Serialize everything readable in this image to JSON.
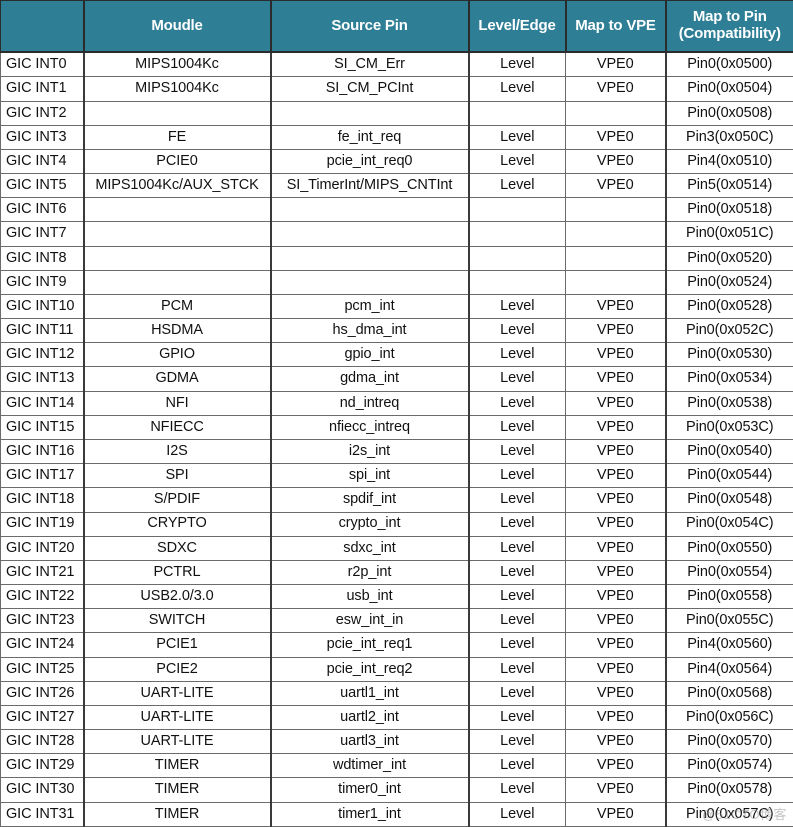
{
  "table": {
    "headers": {
      "interrupt": "",
      "module": "Moudle",
      "source_pin": "Source Pin",
      "level_edge": "Level/Edge",
      "map_to_vpe": "Map to VPE",
      "map_to_pin_line1": "Map to Pin",
      "map_to_pin_line2": "(Compatibility)"
    },
    "header_bg_color": "#2e7f96",
    "header_text_color": "#ffffff",
    "body_text_color": "#111111",
    "rows": [
      {
        "interrupt": "GIC INT0",
        "module": "MIPS1004Kc",
        "source_pin": "SI_CM_Err",
        "level_edge": "Level",
        "map_to_vpe": "VPE0",
        "map_to_pin": "Pin0(0x0500)"
      },
      {
        "interrupt": "GIC INT1",
        "module": "MIPS1004Kc",
        "source_pin": "SI_CM_PCInt",
        "level_edge": "Level",
        "map_to_vpe": "VPE0",
        "map_to_pin": "Pin0(0x0504)"
      },
      {
        "interrupt": "GIC INT2",
        "module": "",
        "source_pin": "",
        "level_edge": "",
        "map_to_vpe": "",
        "map_to_pin": "Pin0(0x0508)"
      },
      {
        "interrupt": "GIC INT3",
        "module": "FE",
        "source_pin": "fe_int_req",
        "level_edge": "Level",
        "map_to_vpe": "VPE0",
        "map_to_pin": "Pin3(0x050C)"
      },
      {
        "interrupt": "GIC INT4",
        "module": "PCIE0",
        "source_pin": "pcie_int_req0",
        "level_edge": "Level",
        "map_to_vpe": "VPE0",
        "map_to_pin": "Pin4(0x0510)"
      },
      {
        "interrupt": "GIC INT5",
        "module": "MIPS1004Kc/AUX_STCK",
        "source_pin": "SI_TimerInt/MIPS_CNTInt",
        "level_edge": "Level",
        "map_to_vpe": "VPE0",
        "map_to_pin": "Pin5(0x0514)"
      },
      {
        "interrupt": "GIC INT6",
        "module": "",
        "source_pin": "",
        "level_edge": "",
        "map_to_vpe": "",
        "map_to_pin": "Pin0(0x0518)"
      },
      {
        "interrupt": "GIC INT7",
        "module": "",
        "source_pin": "",
        "level_edge": "",
        "map_to_vpe": "",
        "map_to_pin": "Pin0(0x051C)"
      },
      {
        "interrupt": "GIC INT8",
        "module": "",
        "source_pin": "",
        "level_edge": "",
        "map_to_vpe": "",
        "map_to_pin": "Pin0(0x0520)"
      },
      {
        "interrupt": "GIC INT9",
        "module": "",
        "source_pin": "",
        "level_edge": "",
        "map_to_vpe": "",
        "map_to_pin": "Pin0(0x0524)"
      },
      {
        "interrupt": "GIC INT10",
        "module": "PCM",
        "source_pin": "pcm_int",
        "level_edge": "Level",
        "map_to_vpe": "VPE0",
        "map_to_pin": "Pin0(0x0528)"
      },
      {
        "interrupt": "GIC INT11",
        "module": "HSDMA",
        "source_pin": "hs_dma_int",
        "level_edge": "Level",
        "map_to_vpe": "VPE0",
        "map_to_pin": "Pin0(0x052C)"
      },
      {
        "interrupt": "GIC INT12",
        "module": "GPIO",
        "source_pin": "gpio_int",
        "level_edge": "Level",
        "map_to_vpe": "VPE0",
        "map_to_pin": "Pin0(0x0530)"
      },
      {
        "interrupt": "GIC INT13",
        "module": "GDMA",
        "source_pin": "gdma_int",
        "level_edge": "Level",
        "map_to_vpe": "VPE0",
        "map_to_pin": "Pin0(0x0534)"
      },
      {
        "interrupt": "GIC INT14",
        "module": "NFI",
        "source_pin": "nd_intreq",
        "level_edge": "Level",
        "map_to_vpe": "VPE0",
        "map_to_pin": "Pin0(0x0538)"
      },
      {
        "interrupt": "GIC INT15",
        "module": "NFIECC",
        "source_pin": "nfiecc_intreq",
        "level_edge": "Level",
        "map_to_vpe": "VPE0",
        "map_to_pin": "Pin0(0x053C)"
      },
      {
        "interrupt": "GIC INT16",
        "module": "I2S",
        "source_pin": "i2s_int",
        "level_edge": "Level",
        "map_to_vpe": "VPE0",
        "map_to_pin": "Pin0(0x0540)"
      },
      {
        "interrupt": "GIC INT17",
        "module": "SPI",
        "source_pin": "spi_int",
        "level_edge": "Level",
        "map_to_vpe": "VPE0",
        "map_to_pin": "Pin0(0x0544)"
      },
      {
        "interrupt": "GIC INT18",
        "module": "S/PDIF",
        "source_pin": "spdif_int",
        "level_edge": "Level",
        "map_to_vpe": "VPE0",
        "map_to_pin": "Pin0(0x0548)"
      },
      {
        "interrupt": "GIC INT19",
        "module": "CRYPTO",
        "source_pin": "crypto_int",
        "level_edge": "Level",
        "map_to_vpe": "VPE0",
        "map_to_pin": "Pin0(0x054C)"
      },
      {
        "interrupt": "GIC INT20",
        "module": "SDXC",
        "source_pin": "sdxc_int",
        "level_edge": "Level",
        "map_to_vpe": "VPE0",
        "map_to_pin": "Pin0(0x0550)"
      },
      {
        "interrupt": "GIC INT21",
        "module": "PCTRL",
        "source_pin": "r2p_int",
        "level_edge": "Level",
        "map_to_vpe": "VPE0",
        "map_to_pin": "Pin0(0x0554)"
      },
      {
        "interrupt": "GIC INT22",
        "module": "USB2.0/3.0",
        "source_pin": "usb_int",
        "level_edge": "Level",
        "map_to_vpe": "VPE0",
        "map_to_pin": "Pin0(0x0558)"
      },
      {
        "interrupt": "GIC INT23",
        "module": "SWITCH",
        "source_pin": "esw_int_in",
        "level_edge": "Level",
        "map_to_vpe": "VPE0",
        "map_to_pin": "Pin0(0x055C)"
      },
      {
        "interrupt": "GIC INT24",
        "module": "PCIE1",
        "source_pin": "pcie_int_req1",
        "level_edge": "Level",
        "map_to_vpe": "VPE0",
        "map_to_pin": "Pin4(0x0560)"
      },
      {
        "interrupt": "GIC INT25",
        "module": "PCIE2",
        "source_pin": "pcie_int_req2",
        "level_edge": "Level",
        "map_to_vpe": "VPE0",
        "map_to_pin": "Pin4(0x0564)"
      },
      {
        "interrupt": "GIC INT26",
        "module": "UART-LITE",
        "source_pin": "uartl1_int",
        "level_edge": "Level",
        "map_to_vpe": "VPE0",
        "map_to_pin": "Pin0(0x0568)"
      },
      {
        "interrupt": "GIC INT27",
        "module": "UART-LITE",
        "source_pin": "uartl2_int",
        "level_edge": "Level",
        "map_to_vpe": "VPE0",
        "map_to_pin": "Pin0(0x056C)"
      },
      {
        "interrupt": "GIC INT28",
        "module": "UART-LITE",
        "source_pin": "uartl3_int",
        "level_edge": "Level",
        "map_to_vpe": "VPE0",
        "map_to_pin": "Pin0(0x0570)"
      },
      {
        "interrupt": "GIC INT29",
        "module": "TIMER",
        "source_pin": "wdtimer_int",
        "level_edge": "Level",
        "map_to_vpe": "VPE0",
        "map_to_pin": "Pin0(0x0574)"
      },
      {
        "interrupt": "GIC INT30",
        "module": "TIMER",
        "source_pin": "timer0_int",
        "level_edge": "Level",
        "map_to_vpe": "VPE0",
        "map_to_pin": "Pin0(0x0578)"
      },
      {
        "interrupt": "GIC INT31",
        "module": "TIMER",
        "source_pin": "timer1_int",
        "level_edge": "Level",
        "map_to_vpe": "VPE0",
        "map_to_pin": "Pin0(0x057C)"
      }
    ]
  },
  "watermark": {
    "text": "@51CTO博客"
  }
}
